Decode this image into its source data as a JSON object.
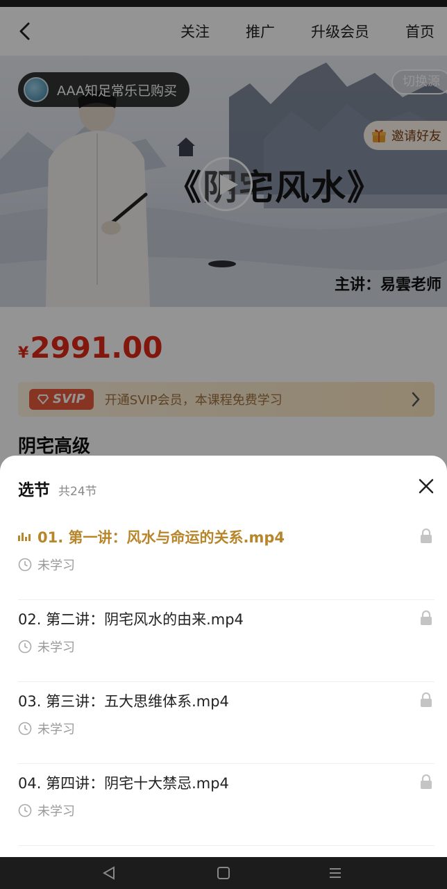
{
  "topbar": {
    "links": [
      "关注",
      "推广",
      "升级会员",
      "首页"
    ]
  },
  "hero": {
    "buyer_text": "AAA知足常乐已购买",
    "switch_source": "切换源",
    "invite": "邀请好友",
    "title": "《阴宅风水》",
    "lecturer": "主讲：易雲老师"
  },
  "price": {
    "currency": "¥",
    "value": "2991.00"
  },
  "svip": {
    "tag": "SVIP",
    "text": "开通SVIP会员，本课程免费学习"
  },
  "course_name": "阴宅高级",
  "sheet": {
    "title": "选节",
    "count": "共24节",
    "lessons": [
      {
        "title": "01. 第一讲：风水与命运的关系.mp4",
        "status": "未学习",
        "active": true
      },
      {
        "title": "02. 第二讲：阴宅风水的由来.mp4",
        "status": "未学习",
        "active": false
      },
      {
        "title": "03. 第三讲：五大思维体系.mp4",
        "status": "未学习",
        "active": false
      },
      {
        "title": "04. 第四讲：阴宅十大禁忌.mp4",
        "status": "未学习",
        "active": false
      }
    ]
  },
  "colors": {
    "price": "#e02a17",
    "active_lesson": "#b8862a",
    "svip_tag": "#ea5a3c"
  }
}
